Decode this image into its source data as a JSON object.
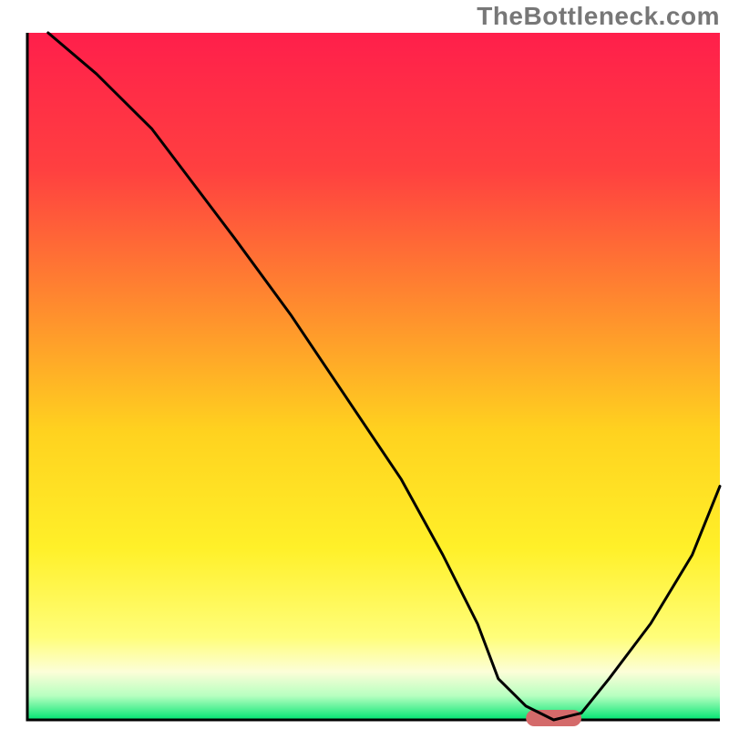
{
  "watermark": "TheBottleneck.com",
  "chart_data": {
    "type": "line",
    "title": "",
    "xlabel": "",
    "ylabel": "",
    "xlim": [
      0,
      100
    ],
    "ylim": [
      0,
      100
    ],
    "grid": false,
    "legend": false,
    "x": [
      3,
      10,
      18,
      24,
      30,
      38,
      46,
      54,
      60,
      65,
      68,
      72,
      76,
      80,
      84,
      90,
      96,
      100
    ],
    "values": [
      100,
      94,
      86,
      78,
      70,
      59,
      47,
      35,
      24,
      14,
      6,
      2,
      0,
      1,
      6,
      14,
      24,
      34
    ],
    "series_name": "bottleneck-curve",
    "marker": {
      "x_range": [
        72,
        80
      ],
      "y": 0,
      "color": "#d46a6a",
      "thickness": 2.5
    },
    "gradient_stops": [
      {
        "offset": 0.0,
        "color": "#ff1f4b"
      },
      {
        "offset": 0.2,
        "color": "#ff4040"
      },
      {
        "offset": 0.4,
        "color": "#ff8c2e"
      },
      {
        "offset": 0.58,
        "color": "#ffd21f"
      },
      {
        "offset": 0.75,
        "color": "#fff029"
      },
      {
        "offset": 0.88,
        "color": "#fffe7a"
      },
      {
        "offset": 0.93,
        "color": "#fcfed8"
      },
      {
        "offset": 0.965,
        "color": "#b7ffc0"
      },
      {
        "offset": 1.0,
        "color": "#00e472"
      }
    ],
    "axis_color": "#000000",
    "axis_width": 3
  }
}
